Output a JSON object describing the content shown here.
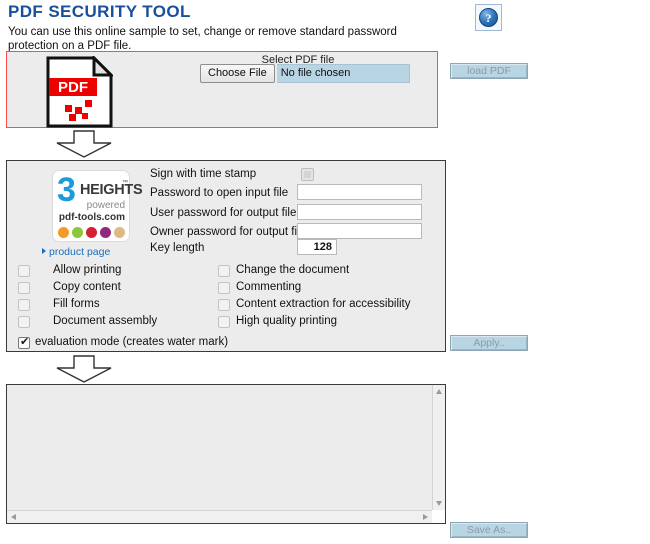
{
  "header": {
    "title": "PDF SECURITY TOOL",
    "intro": "You can use this online sample to set, change or remove standard password protection on a PDF file.",
    "help_icon": "help-circle-icon",
    "title_color": "#1a4f9c"
  },
  "upload": {
    "panel_border_color": "#ff4d4d",
    "pdf_icon_label": "PDF",
    "select_label": "Select PDF file",
    "choose_file_label": "Choose File",
    "file_name_value": "No file chosen",
    "load_button_label": "load PDF",
    "load_button_enabled": false
  },
  "logo": {
    "numeral": "3",
    "wordmark": "HEIGHTS",
    "trademark": "™",
    "powered": "powered",
    "domain": "pdf-tools.com",
    "product_link": "product page",
    "dot_colors": [
      "#f49a2b",
      "#8cc63e",
      "#d41f35",
      "#8e2a7d",
      "#ddb983"
    ]
  },
  "options": {
    "timestamp": {
      "label": "Sign with time stamp",
      "checked": false,
      "disabled": true
    },
    "fields": [
      {
        "label": "Password to open input file",
        "value": "",
        "placeholder": ""
      },
      {
        "label": "User password for output file",
        "value": "",
        "placeholder": ""
      },
      {
        "label": "Owner password for output file",
        "value": "",
        "placeholder": ""
      }
    ],
    "key_length": {
      "label": "Key length",
      "value": "128"
    },
    "permissions_left": [
      {
        "label": "Allow printing",
        "checked": false
      },
      {
        "label": "Copy content",
        "checked": false
      },
      {
        "label": "Fill forms",
        "checked": false
      },
      {
        "label": "Document assembly",
        "checked": false
      }
    ],
    "permissions_right": [
      {
        "label": "Change the document",
        "checked": false
      },
      {
        "label": "Commenting",
        "checked": false
      },
      {
        "label": "Content extraction for accessibility",
        "checked": false
      },
      {
        "label": "High quality printing",
        "checked": false
      }
    ],
    "evaluation_mode": {
      "label": "evaluation mode (creates water mark)",
      "checked": true
    },
    "apply_button_label": "Apply..",
    "apply_button_enabled": false
  },
  "output": {
    "text_value": "",
    "save_button_label": "Save As..",
    "save_button_enabled": false
  }
}
